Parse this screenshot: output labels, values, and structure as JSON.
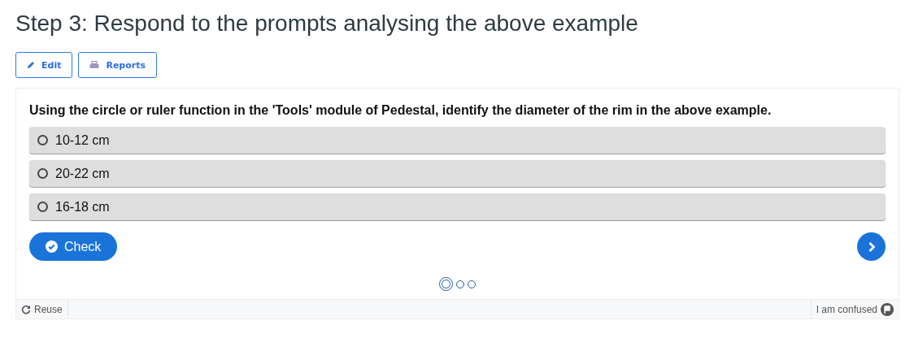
{
  "title": "Step 3: Respond to the prompts analysing the above example",
  "toolbar": [
    {
      "kind": "edit",
      "label": "Edit"
    },
    {
      "kind": "reports",
      "label": "Reports"
    }
  ],
  "question": "Using the circle or ruler function in the 'Tools' module of Pedestal, identify the diameter of the rim in the above example.",
  "options": [
    {
      "label": "10-12 cm",
      "selected": false
    },
    {
      "label": "20-22 cm",
      "selected": false
    },
    {
      "label": "16-18 cm",
      "selected": false
    }
  ],
  "check_button": "Check",
  "pager": [
    {
      "selected": true
    },
    {
      "selected": false
    },
    {
      "selected": false
    }
  ],
  "footer": {
    "reuse": "Reuse",
    "confused": "I am confused"
  }
}
